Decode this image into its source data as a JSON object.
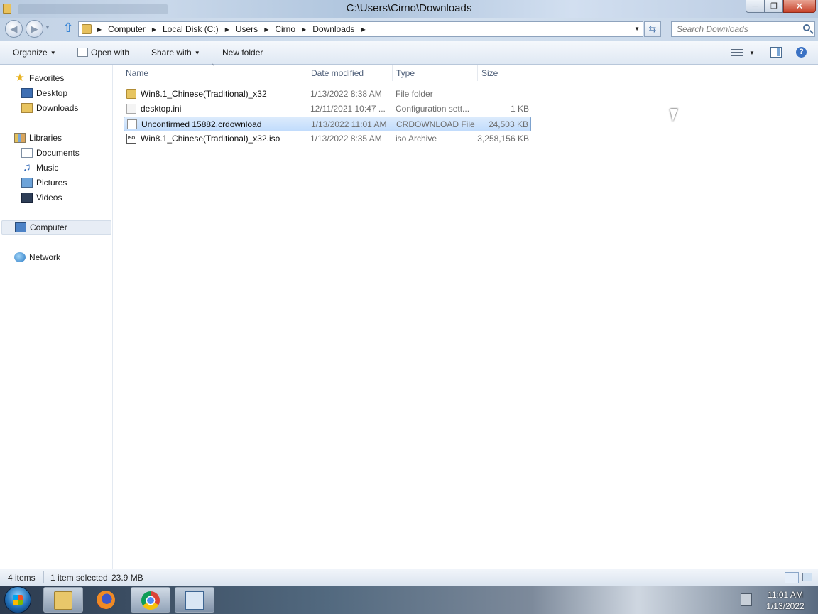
{
  "window": {
    "title": "C:\\Users\\Cirno\\Downloads"
  },
  "address": {
    "breadcrumbs": [
      "Computer",
      "Local Disk (C:)",
      "Users",
      "Cirno",
      "Downloads"
    ],
    "search_placeholder": "Search Downloads"
  },
  "toolbar": {
    "organize": "Organize",
    "open_with": "Open with",
    "share_with": "Share with",
    "new_folder": "New folder"
  },
  "nav": {
    "favorites": "Favorites",
    "desktop": "Desktop",
    "downloads": "Downloads",
    "libraries": "Libraries",
    "documents": "Documents",
    "music": "Music",
    "pictures": "Pictures",
    "videos": "Videos",
    "computer": "Computer",
    "network": "Network"
  },
  "columns": {
    "name": "Name",
    "date": "Date modified",
    "type": "Type",
    "size": "Size"
  },
  "files": [
    {
      "name": "Win8.1_Chinese(Traditional)_x32",
      "date": "1/13/2022 8:38 AM",
      "type": "File folder",
      "size": "",
      "icon": "folder-icon"
    },
    {
      "name": "desktop.ini",
      "date": "12/11/2021 10:47 ...",
      "type": "Configuration sett...",
      "size": "1 KB",
      "icon": "config-file-icon"
    },
    {
      "name": "Unconfirmed 15882.crdownload",
      "date": "1/13/2022 11:01 AM",
      "type": "CRDOWNLOAD File",
      "size": "24,503 KB",
      "icon": "blank-file-icon",
      "selected": true
    },
    {
      "name": "Win8.1_Chinese(Traditional)_x32.iso",
      "date": "1/13/2022 8:35 AM",
      "type": "iso Archive",
      "size": "3,258,156 KB",
      "icon": "iso-file-icon"
    }
  ],
  "status": {
    "item_count": "4 items",
    "selected": "1 item selected",
    "selected_size": "23.9 MB"
  },
  "taskbar": {
    "time": "11:01 AM",
    "date": "1/13/2022"
  },
  "colors": {
    "selection": "#cce4fc",
    "titlebar": "#c3d3e6"
  }
}
